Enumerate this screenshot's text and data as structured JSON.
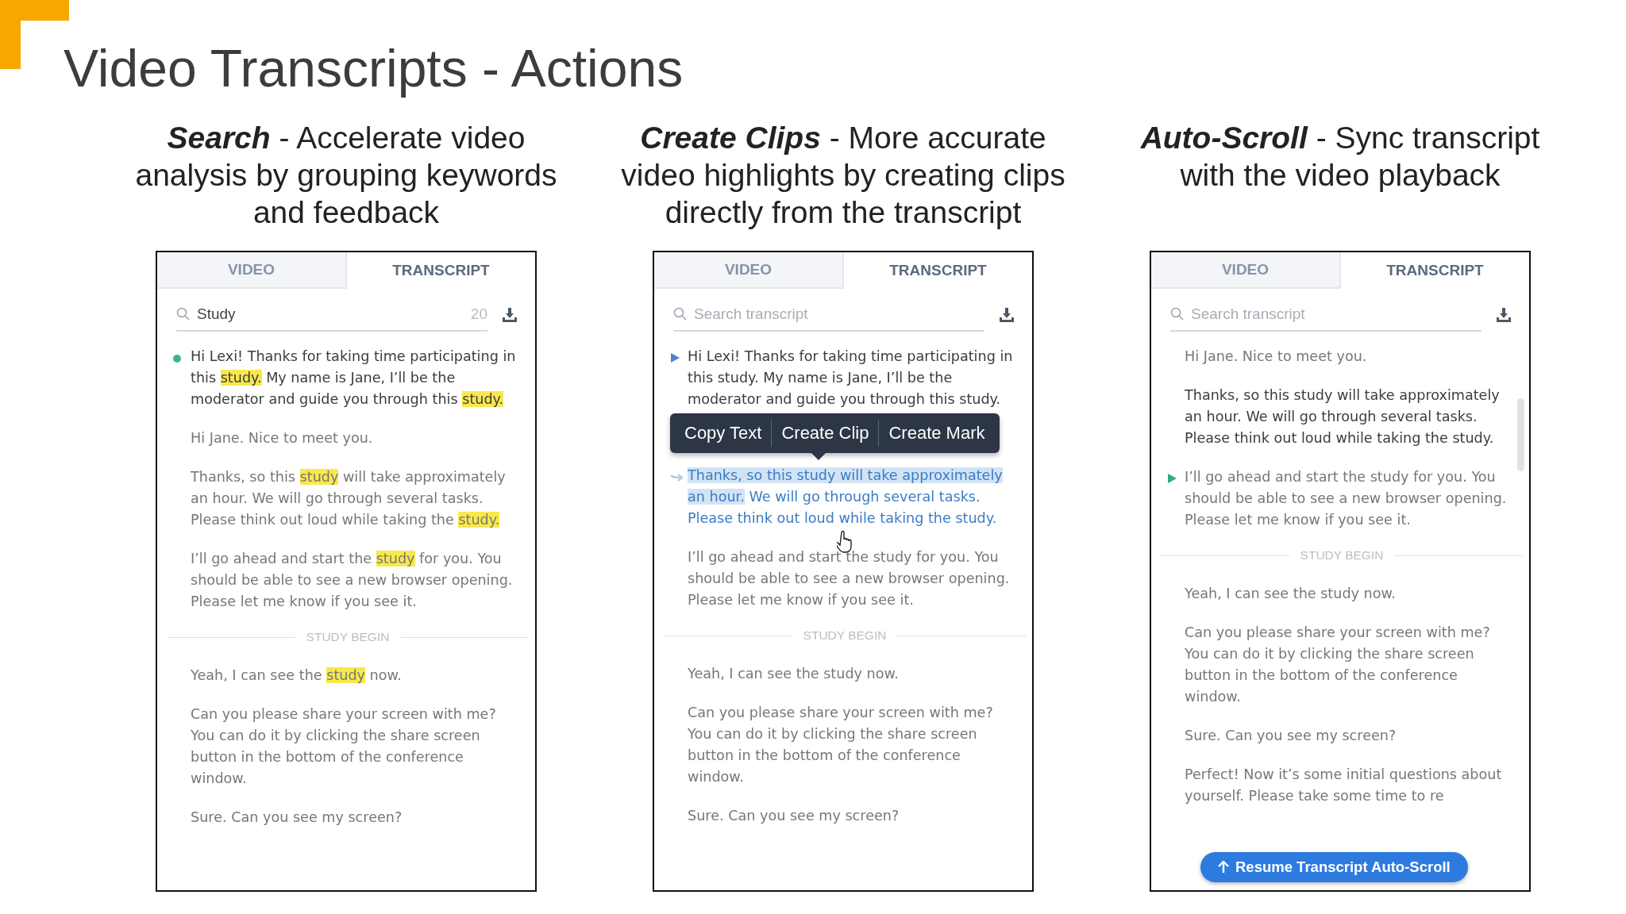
{
  "title": "Video Transcripts - Actions",
  "panels": [
    {
      "caption": "**Search** - Accelerate video analysis by grouping keywords and feedback",
      "tabs": [
        {
          "label": "VIDEO",
          "selected": false
        },
        {
          "label": "TRANSCRIPT",
          "selected": true
        }
      ],
      "search": {
        "value": "Study",
        "count": "20"
      },
      "entries": [
        {
          "kind": "line",
          "emphasized": true,
          "marker": {
            "kind": "dot"
          },
          "segments": [
            {
              "text": "Hi Lexi! Thanks for taking time participating in this ",
              "highlighted": false
            },
            {
              "text": "study.",
              "highlighted": true
            },
            {
              "text": " My name is Jane, I’ll be the moderator and guide you through this ",
              "highlighted": false
            },
            {
              "text": "study.",
              "highlighted": true
            }
          ]
        },
        {
          "kind": "line",
          "emphasized": false,
          "segments": [
            {
              "text": "Hi Jane. Nice to meet you.",
              "highlighted": false
            }
          ]
        },
        {
          "kind": "line",
          "emphasized": false,
          "segments": [
            {
              "text": "Thanks, so this ",
              "highlighted": false
            },
            {
              "text": "study",
              "highlighted": true
            },
            {
              "text": " will take approximately an hour. We will go through several tasks. Please think out loud while taking the ",
              "highlighted": false
            },
            {
              "text": "study.",
              "highlighted": true
            }
          ]
        },
        {
          "kind": "line",
          "emphasized": false,
          "segments": [
            {
              "text": "I’ll go ahead and start the ",
              "highlighted": false
            },
            {
              "text": "study",
              "highlighted": true
            },
            {
              "text": " for you. You should be able to see a new browser opening. Please let me know if you see it.",
              "highlighted": false
            }
          ]
        },
        {
          "kind": "divider",
          "label": "STUDY BEGIN"
        },
        {
          "kind": "line",
          "emphasized": false,
          "segments": [
            {
              "text": "Yeah, I can see the ",
              "highlighted": false
            },
            {
              "text": "study",
              "highlighted": true
            },
            {
              "text": " now.",
              "highlighted": false
            }
          ]
        },
        {
          "kind": "line",
          "emphasized": false,
          "segments": [
            {
              "text": "Can you please share your screen with me? You can do it by clicking the share screen button in the bottom of the conference window.",
              "highlighted": false
            }
          ]
        },
        {
          "kind": "line",
          "emphasized": false,
          "segments": [
            {
              "text": "Sure. Can you see my screen?",
              "highlighted": false
            }
          ]
        }
      ]
    },
    {
      "caption": "**Create Clips** - More accurate video highlights by creating clips directly from the transcript",
      "tabs": [
        {
          "label": "VIDEO",
          "selected": false
        },
        {
          "label": "TRANSCRIPT",
          "selected": true
        }
      ],
      "search": {
        "placeholder": "Search transcript"
      },
      "entries": [
        {
          "kind": "line",
          "emphasized": true,
          "selected": false,
          "marker": {
            "kind": "play"
          },
          "segments": [
            {
              "text": "Hi Lexi! Thanks for taking time participating in this study. My name is Jane, I’ll be the moderator and guide you through this study.",
              "selected": false
            }
          ]
        },
        {
          "kind": "line",
          "selected": true,
          "marker": {
            "kind": "reply"
          },
          "menu": [
            "Copy Text",
            "Create Clip",
            "Create Mark"
          ],
          "segments": [
            {
              "text": "Thanks, so this study will take approximately an hour.",
              "selected": true
            },
            {
              "text": " We will go through several tasks. Please think out loud while taking the study.",
              "selected": false
            }
          ]
        },
        {
          "kind": "line",
          "emphasized": false,
          "selected": false,
          "segments": [
            {
              "text": "I’ll go ahead and start the study for you. You should be able to see a new browser opening. Please let me know if you see it.",
              "selected": false
            }
          ]
        },
        {
          "kind": "divider",
          "label": "STUDY BEGIN"
        },
        {
          "kind": "line",
          "emphasized": false,
          "selected": false,
          "segments": [
            {
              "text": "Yeah, I can see the study now.",
              "selected": false
            }
          ]
        },
        {
          "kind": "line",
          "emphasized": false,
          "selected": false,
          "segments": [
            {
              "text": "Can you please share your screen with me? You can do it by clicking the share screen button in the bottom of the conference window.",
              "selected": false
            }
          ]
        },
        {
          "kind": "line",
          "emphasized": false,
          "selected": false,
          "segments": [
            {
              "text": "Sure. Can you see my screen?",
              "selected": false
            }
          ]
        }
      ]
    },
    {
      "caption": "**Auto-Scroll** - Sync transcript with the video playback",
      "tabs": [
        {
          "label": "VIDEO",
          "selected": false
        },
        {
          "label": "TRANSCRIPT",
          "selected": true
        }
      ],
      "search": {
        "placeholder": "Search transcript"
      },
      "entries": [
        {
          "kind": "line",
          "emphasized": false,
          "segments": [
            {
              "text": "Hi Jane. Nice to meet you."
            }
          ]
        },
        {
          "kind": "line",
          "emphasized": true,
          "segments": [
            {
              "text": "Thanks, so this study will take approximately an hour. We will go through several tasks. Please think out loud while taking the study."
            }
          ]
        },
        {
          "kind": "line",
          "emphasized": false,
          "marker": {
            "kind": "playing"
          },
          "segments": [
            {
              "text": "I’ll go ahead and start the study for you. You should be able to see a new browser opening. Please let me know if you see it."
            }
          ]
        },
        {
          "kind": "divider",
          "label": "STUDY BEGIN"
        },
        {
          "kind": "line",
          "emphasized": false,
          "segments": [
            {
              "text": "Yeah, I can see the study now."
            }
          ]
        },
        {
          "kind": "line",
          "emphasized": false,
          "segments": [
            {
              "text": "Can you please share your screen with me? You can do it by clicking the share screen button in the bottom of the conference window."
            }
          ]
        },
        {
          "kind": "line",
          "emphasized": false,
          "segments": [
            {
              "text": "Sure. Can you see my screen?"
            }
          ]
        },
        {
          "kind": "line",
          "emphasized": false,
          "segments": [
            {
              "text": "Perfect! Now it’s some initial questions about yourself. Please take some time to re"
            }
          ]
        }
      ],
      "resume_button": "Resume Transcript Auto-Scroll"
    }
  ]
}
